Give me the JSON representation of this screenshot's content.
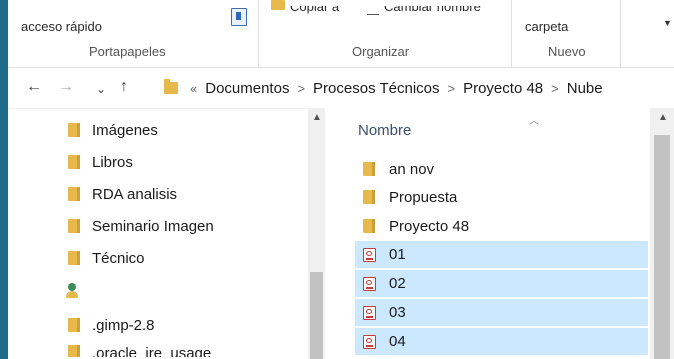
{
  "ribbon": {
    "quick_access": "acceso rápido",
    "copy_to": "Copiar a",
    "rename": "Cambiar nombre",
    "new_folder_part": "carpeta",
    "groups": [
      "Portapapeles",
      "Organizar",
      "Nuevo"
    ]
  },
  "address": {
    "overflow": "«",
    "crumbs": [
      "Documentos",
      "Procesos Técnicos",
      "Proyecto 48",
      "Nube"
    ]
  },
  "nav_pane": {
    "items": [
      "Imágenes",
      "Libros",
      "RDA analisis",
      "Seminario Imagen",
      "Técnico",
      ".gimp-2.8",
      ".oracle_jre_usage"
    ]
  },
  "file_list": {
    "column_name": "Nombre",
    "items": [
      {
        "name": "an nov",
        "type": "folder",
        "selected": false
      },
      {
        "name": "Propuesta",
        "type": "folder",
        "selected": false
      },
      {
        "name": "Proyecto 48",
        "type": "folder",
        "selected": false
      },
      {
        "name": "01",
        "type": "pdf",
        "selected": true
      },
      {
        "name": "02",
        "type": "pdf",
        "selected": true
      },
      {
        "name": "03",
        "type": "pdf",
        "selected": true
      },
      {
        "name": "04",
        "type": "pdf",
        "selected": true
      }
    ]
  },
  "colors": {
    "accent_selection": "#cce8ff",
    "folder": "#e7b84a",
    "desktop": "#1f6a88"
  },
  "icons": {
    "back": "arrow-left-icon",
    "forward": "arrow-right-icon",
    "recent": "chevron-down-icon",
    "up": "arrow-up-icon",
    "folder": "folder-icon",
    "pdf": "pdf-file-icon",
    "user": "user-folder-icon"
  }
}
